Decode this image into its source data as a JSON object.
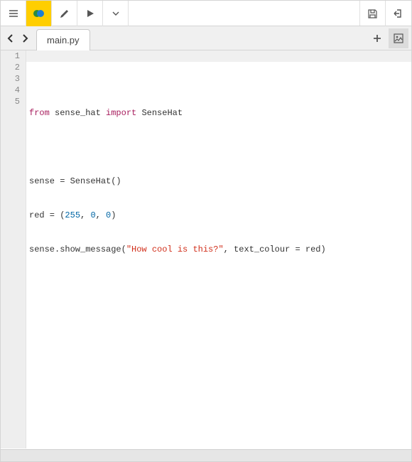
{
  "tab": {
    "filename": "main.py"
  },
  "editor": {
    "line_numbers": [
      "1",
      "2",
      "3",
      "4",
      "5"
    ],
    "code": {
      "l1": {
        "kw1": "from",
        "mod": " sense_hat ",
        "kw2": "import",
        "cls": " SenseHat"
      },
      "l2": "",
      "l3": "sense = SenseHat()",
      "l4": {
        "pre": "red = (",
        "n1": "255",
        "c1": ", ",
        "n2": "0",
        "c2": ", ",
        "n3": "0",
        "post": ")"
      },
      "l5": {
        "pre": "sense.show_message(",
        "str": "\"How cool is this?\"",
        "post": ", text_colour = red)"
      }
    }
  }
}
